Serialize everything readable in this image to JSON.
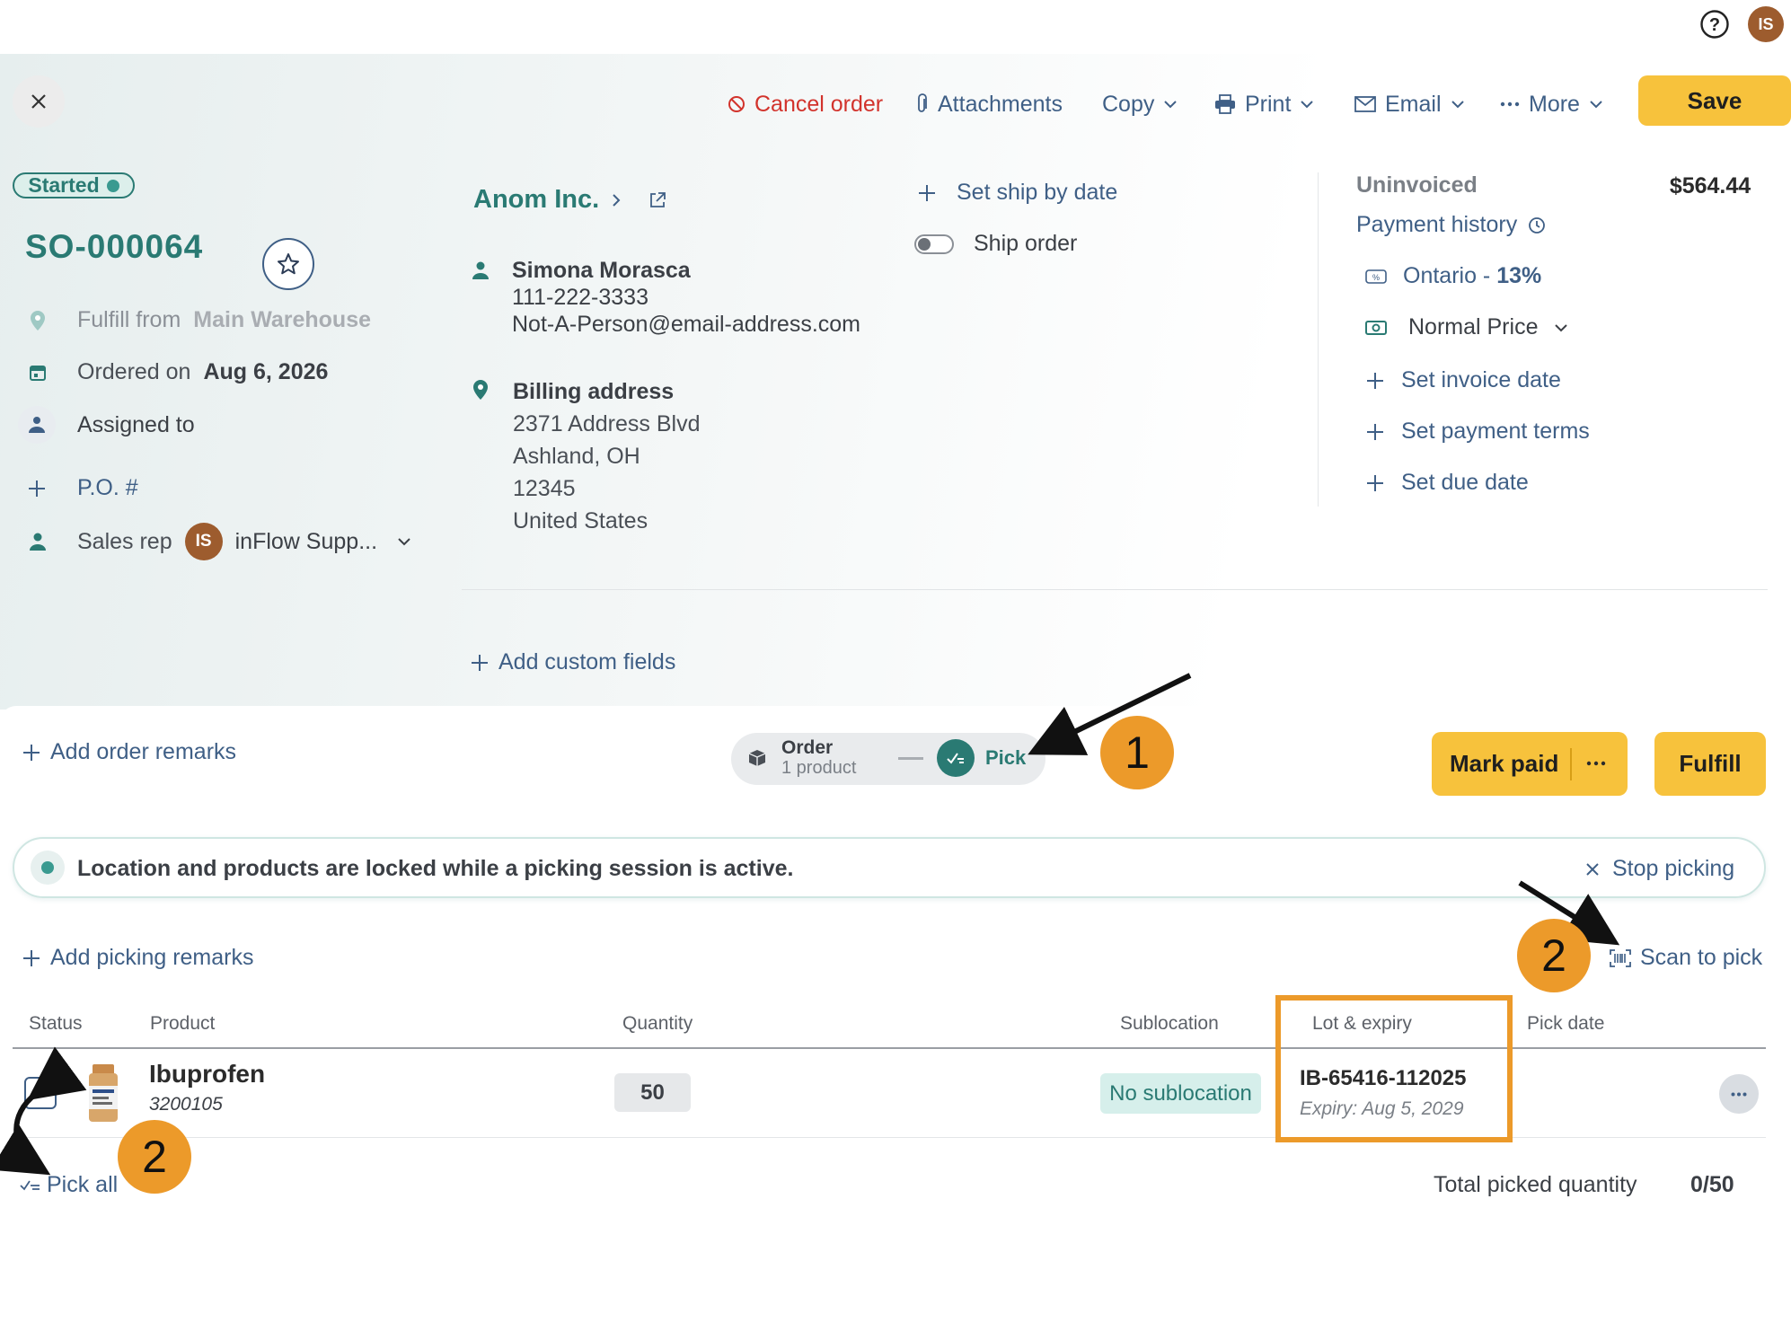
{
  "topbar": {
    "help_icon": "question-circle-icon",
    "avatar_initials": "IS"
  },
  "toolbar": {
    "cancel_label": "Cancel order",
    "attachments_label": "Attachments",
    "copy_label": "Copy",
    "print_label": "Print",
    "email_label": "Email",
    "more_label": "More",
    "save_label": "Save"
  },
  "order": {
    "status": "Started",
    "number": "SO-000064",
    "fulfill_label": "Fulfill from",
    "fulfill_location": "Main Warehouse",
    "ordered_label": "Ordered on",
    "ordered_date": "Aug 6, 2026",
    "assigned_label": "Assigned to",
    "po_label": "P.O. #",
    "sales_rep_label": "Sales rep",
    "sales_rep_initials": "IS",
    "sales_rep_name": "inFlow Supp..."
  },
  "customer": {
    "name": "Anom Inc.",
    "contact_name": "Simona Morasca",
    "phone": "111-222-3333",
    "email": "Not-A-Person@email-address.com",
    "billing_title": "Billing address",
    "billing_lines": [
      "2371 Address Blvd",
      "Ashland, OH",
      "12345",
      "United States"
    ]
  },
  "shipping": {
    "set_ship_by_label": "Set ship by date",
    "ship_order_label": "Ship order"
  },
  "invoice": {
    "status": "Uninvoiced",
    "total": "$564.44",
    "payment_history_label": "Payment history",
    "tax_region": "Ontario - ",
    "tax_rate": "13%",
    "pricing": "Normal Price",
    "set_invoice_date": "Set invoice date",
    "set_payment_terms": "Set payment terms",
    "set_due_date": "Set due date"
  },
  "add_custom_fields_label": "Add custom fields",
  "add_order_remarks_label": "Add order remarks",
  "stepper": {
    "order_label": "Order",
    "order_sub": "1 product",
    "pick_label": "Pick"
  },
  "actions": {
    "mark_paid_label": "Mark paid",
    "fulfill_label": "Fulfill"
  },
  "banner": {
    "text": "Location and products are locked while a picking session is active.",
    "stop_label": "Stop picking"
  },
  "picking": {
    "add_remarks_label": "Add picking remarks",
    "scan_label": "Scan to pick",
    "columns": [
      "Status",
      "Product",
      "Quantity",
      "Sublocation",
      "Lot & expiry",
      "Pick date"
    ],
    "rows": [
      {
        "product": "Ibuprofen",
        "sku": "3200105",
        "quantity": "50",
        "sublocation": "No sublocation",
        "lot": "IB-65416-112025",
        "expiry": "Expiry: Aug 5, 2029"
      }
    ],
    "pick_all_label": "Pick all",
    "total_label": "Total picked quantity",
    "total_value": "0/50"
  },
  "callouts": {
    "one": "1",
    "two_a": "2",
    "two_b": "2"
  },
  "colors": {
    "accent": "#2a7a73",
    "link": "#3f5f86",
    "primary_button": "#f7c23c",
    "danger": "#d2332c",
    "callout": "#ec9a2a"
  }
}
